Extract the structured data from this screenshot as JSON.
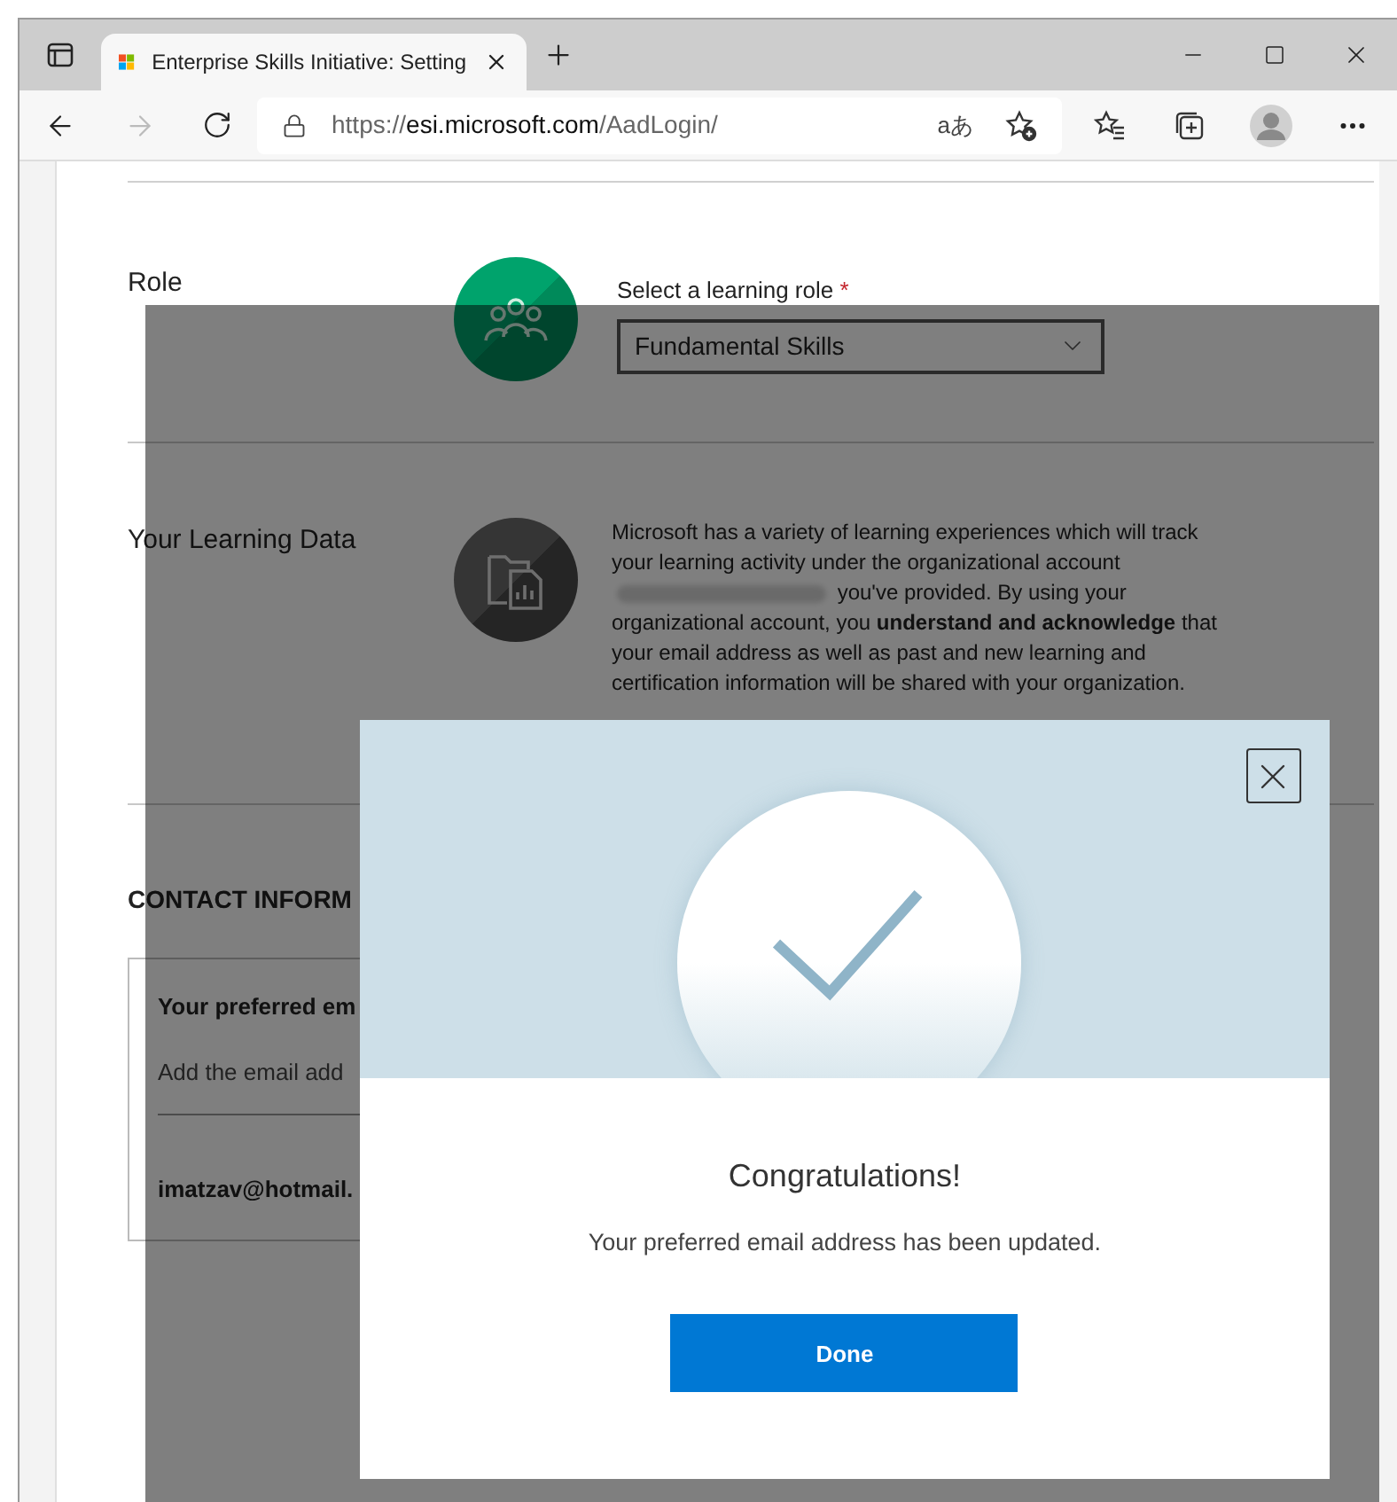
{
  "browser": {
    "tab_title": "Enterprise Skills Initiative: Setting",
    "url": {
      "scheme": "https://",
      "host": "esi.microsoft.com",
      "path": "/AadLogin/"
    },
    "read_aloud": "aあ",
    "forward_disabled": true
  },
  "role": {
    "label": "Role",
    "field_label": "Select a learning role",
    "required_mark": "*",
    "dropdown_value": "Fundamental Skills"
  },
  "learning_data": {
    "label": "Your Learning Data",
    "text_before": "Microsoft has a variety of learning experiences which will track your learning activity under the organizational account",
    "text_after": "you've provided. By using your organizational account, you **understand and acknowledge** that your email address as well as past and new learning and certification information will be shared with your organization."
  },
  "contact": {
    "heading": "CONTACT INFORM",
    "preferred_label": "Your preferred em",
    "hint": "Add the email add",
    "email": "imatzav@hotmail."
  },
  "modal": {
    "title": "Congratulations!",
    "message": "Your preferred email address has been updated.",
    "button": "Done"
  }
}
